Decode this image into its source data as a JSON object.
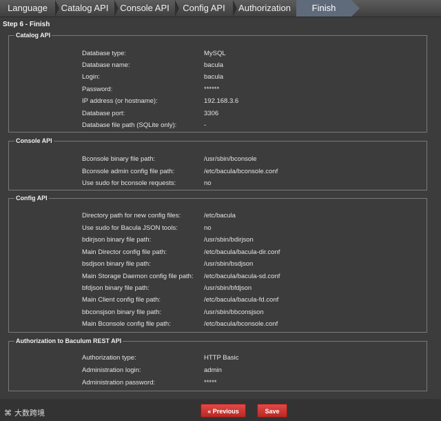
{
  "steps": [
    {
      "label": "Language"
    },
    {
      "label": "Catalog API"
    },
    {
      "label": "Console API"
    },
    {
      "label": "Config API"
    },
    {
      "label": "Authorization"
    },
    {
      "label": "Finish"
    }
  ],
  "active_step": "Finish",
  "step_title": "Step 6 - Finish",
  "sections": {
    "catalog": {
      "legend": "Catalog API",
      "rows": [
        {
          "label": "Database type:",
          "value": "MySQL"
        },
        {
          "label": "Database name:",
          "value": "bacula"
        },
        {
          "label": "Login:",
          "value": "bacula"
        },
        {
          "label": "Password:",
          "value": "******"
        },
        {
          "label": "IP address (or hostname):",
          "value": "192.168.3.6"
        },
        {
          "label": "Database port:",
          "value": "3306"
        },
        {
          "label": "Database file path (SQLite only):",
          "value": "-"
        }
      ]
    },
    "console": {
      "legend": "Console API",
      "rows": [
        {
          "label": "Bconsole binary file path:",
          "value": "/usr/sbin/bconsole"
        },
        {
          "label": "Bconsole admin config file path:",
          "value": "/etc/bacula/bconsole.conf"
        },
        {
          "label": "Use sudo for bconsole requests:",
          "value": "no"
        }
      ]
    },
    "config": {
      "legend": "Config API",
      "rows": [
        {
          "label": "Directory path for new config files:",
          "value": "/etc/bacula"
        },
        {
          "label": "Use sudo for Bacula JSON tools:",
          "value": "no"
        },
        {
          "label": "bdirjson binary file path:",
          "value": "/usr/sbin/bdirjson"
        },
        {
          "label": "Main Director config file path:",
          "value": "/etc/bacula/bacula-dir.conf"
        },
        {
          "label": "bsdjson binary file path:",
          "value": "/usr/sbin/bsdjson"
        },
        {
          "label": "Main Storage Daemon config file path:",
          "value": "/etc/bacula/bacula-sd.conf"
        },
        {
          "label": "bfdjson binary file path:",
          "value": "/usr/sbin/bfdjson"
        },
        {
          "label": "Main Client config file path:",
          "value": "/etc/bacula/bacula-fd.conf"
        },
        {
          "label": "bbconsjson binary file path:",
          "value": "/usr/sbin/bbconsjson"
        },
        {
          "label": "Main Bconsole config file path:",
          "value": "/etc/bacula/bconsole.conf"
        }
      ]
    },
    "auth": {
      "legend": "Authorization to Baculum REST API",
      "rows": [
        {
          "label": "Authorization type:",
          "value": "HTTP Basic"
        },
        {
          "label": "Administration login:",
          "value": "admin"
        },
        {
          "label": "Administration password:",
          "value": "*****"
        }
      ]
    }
  },
  "buttons": {
    "previous": "« Previous",
    "save": "Save"
  },
  "watermark": "大数跨境",
  "colors": {
    "background": "#3c3c3c",
    "active_step": "#5f6a7a",
    "button": "#c9302c"
  }
}
